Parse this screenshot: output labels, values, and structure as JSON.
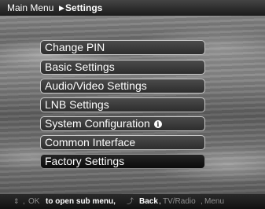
{
  "breadcrumb": {
    "root": "Main Menu",
    "separator": "▶",
    "current": "Settings"
  },
  "menu": {
    "items": [
      {
        "label": "Change PIN"
      },
      {
        "label": "Basic Settings"
      },
      {
        "label": "Audio/Video Settings"
      },
      {
        "label": "LNB Settings"
      },
      {
        "label": "System Configuration",
        "icon": "info-icon",
        "icon_glyph": "i"
      },
      {
        "label": "Common Interface"
      },
      {
        "label": "Factory Settings",
        "selected": true
      }
    ]
  },
  "footer": {
    "updown_icon": "up-down-arrows-icon",
    "updown_glyph": "⇕",
    "comma": ",",
    "ok_label": "OK",
    "open_text": "to open sub menu,",
    "back_icon": "back-arrow-icon",
    "back_glyph": "⤴",
    "back_label": "Back",
    "tvradio_label": "TV/Radio",
    "menu_label": "Menu"
  },
  "colors": {
    "text": "#ffffff",
    "dim_text": "#8f8f8f",
    "item_bg": "#3a3a3a",
    "item_border": "#c9c9c9",
    "selected_bg": "#141414"
  }
}
